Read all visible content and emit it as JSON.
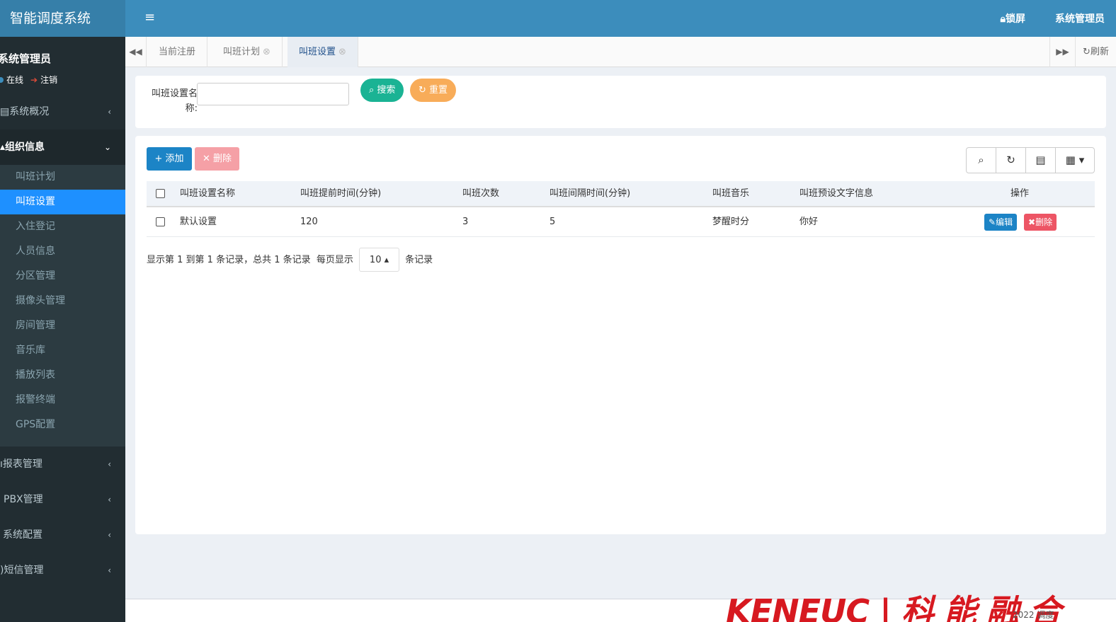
{
  "app": {
    "title": "智能调度系统"
  },
  "user": {
    "name": "系统管理员",
    "status": "在线",
    "logout": "注销"
  },
  "topbar": {
    "lock": "锁屏",
    "admin": "系统管理员"
  },
  "sidebar": {
    "menus": [
      {
        "label": "系统概况"
      },
      {
        "label": "组织信息"
      },
      {
        "label": "报表管理"
      },
      {
        "label": "PBX管理"
      },
      {
        "label": "系统配置"
      },
      {
        "label": "短信管理"
      }
    ],
    "submenu": [
      {
        "label": "叫班计划"
      },
      {
        "label": "叫班设置"
      },
      {
        "label": "入住登记"
      },
      {
        "label": "人员信息"
      },
      {
        "label": "分区管理"
      },
      {
        "label": "摄像头管理"
      },
      {
        "label": "房间管理"
      },
      {
        "label": "音乐库"
      },
      {
        "label": "播放列表"
      },
      {
        "label": "报警终端"
      },
      {
        "label": "GPS配置"
      }
    ]
  },
  "tabs": [
    {
      "label": "当前注册"
    },
    {
      "label": "叫班计划"
    },
    {
      "label": "叫班设置"
    }
  ],
  "refresh_label": "刷新",
  "search": {
    "label": "叫班设置名称:",
    "search_btn": "搜索",
    "reset_btn": "重置"
  },
  "toolbar": {
    "add": "添加",
    "delete": "删除"
  },
  "table": {
    "headers": [
      "叫班设置名称",
      "叫班提前时间(分钟)",
      "叫班次数",
      "叫班间隔时间(分钟)",
      "叫班音乐",
      "叫班预设文字信息",
      "操作"
    ],
    "rows": [
      {
        "name": "默认设置",
        "advance": "120",
        "count": "3",
        "interval": "5",
        "music": "梦醒时分",
        "text": "你好",
        "edit": "编辑",
        "del": "删除"
      }
    ]
  },
  "pager": {
    "info": "显示第 1 到第 1 条记录，总共 1 条记录",
    "per_page": "每页显示",
    "size": "10",
    "suffix": "条记录"
  },
  "footer": {
    "logo_text": "KENEUC",
    "logo_cn": "科 能 融 合",
    "text": "2022 调度 "
  },
  "colors": {
    "sidebar": "#222d32",
    "topbar": "#3c8dbc",
    "active": "#1e90ff",
    "search_btn": "#1ab394",
    "reset_btn": "#f8ac59",
    "add_btn": "#1c84c6",
    "del_btn": "#ed5565"
  }
}
